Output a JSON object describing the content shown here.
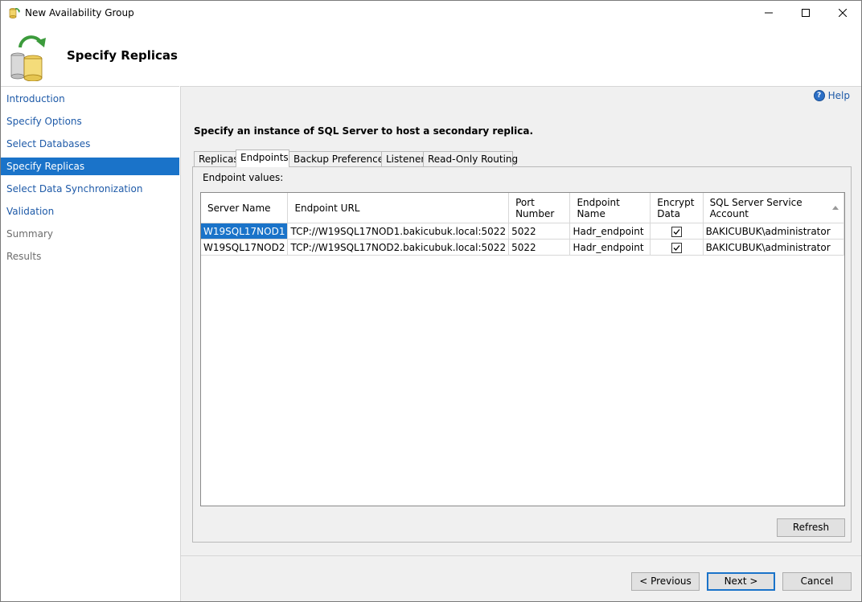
{
  "window": {
    "title": "New Availability Group"
  },
  "header": {
    "page_title": "Specify Replicas"
  },
  "nav": {
    "items": [
      {
        "label": "Introduction",
        "state": "link"
      },
      {
        "label": "Specify Options",
        "state": "link"
      },
      {
        "label": "Select Databases",
        "state": "link"
      },
      {
        "label": "Specify Replicas",
        "state": "active"
      },
      {
        "label": "Select Data Synchronization",
        "state": "link"
      },
      {
        "label": "Validation",
        "state": "link"
      },
      {
        "label": "Summary",
        "state": "disabled"
      },
      {
        "label": "Results",
        "state": "disabled"
      }
    ]
  },
  "content": {
    "help_label": "Help",
    "instruction": "Specify an instance of SQL Server to host a secondary replica.",
    "tabs": [
      "Replicas",
      "Endpoints",
      "Backup Preferences",
      "Listener",
      "Read-Only Routing"
    ],
    "active_tab": "Endpoints",
    "panel_label": "Endpoint values:",
    "columns": [
      "Server Name",
      "Endpoint URL",
      "Port Number",
      "Endpoint Name",
      "Encrypt Data",
      "SQL Server Service Account"
    ],
    "rows": [
      {
        "server": "W19SQL17NOD1",
        "url": "TCP://W19SQL17NOD1.bakicubuk.local:5022",
        "port": "5022",
        "endpoint": "Hadr_endpoint",
        "encrypt": true,
        "account": "BAKICUBUK\\administrator"
      },
      {
        "server": "W19SQL17NOD2",
        "url": "TCP://W19SQL17NOD2.bakicubuk.local:5022",
        "port": "5022",
        "endpoint": "Hadr_endpoint",
        "encrypt": true,
        "account": "BAKICUBUK\\administrator"
      }
    ],
    "refresh_label": "Refresh"
  },
  "footer": {
    "previous_label": "< Previous",
    "next_label": "Next >",
    "cancel_label": "Cancel"
  },
  "colors": {
    "accent": "#1a73c9",
    "link": "#1e5aa8",
    "panel_bg": "#f0f0f0"
  }
}
